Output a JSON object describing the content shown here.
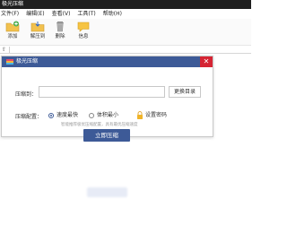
{
  "window": {
    "title": "极光压缩"
  },
  "menu": [
    {
      "label": "文件(F)"
    },
    {
      "label": "编辑(E)"
    },
    {
      "label": "查看(V)"
    },
    {
      "label": "工具(T)"
    },
    {
      "label": "帮助(H)"
    }
  ],
  "toolbar": {
    "add": "添加",
    "extract": "解压到",
    "delete": "删除",
    "info": "信息"
  },
  "dialog": {
    "title": "极光压缩",
    "close": "✕",
    "dest_label": "压缩到：",
    "dest_value": "",
    "change_dir": "更换目录",
    "config_label": "压缩配置：",
    "options": [
      {
        "label": "速度最快",
        "selected": true
      },
      {
        "label": "体积最小",
        "selected": false
      }
    ],
    "password": "设置密码",
    "hint": "智能推荐极优压缩配置，具有最优压缩速度",
    "submit": "立即压缩"
  },
  "colors": {
    "accent": "#3d5a97",
    "close": "#d52433",
    "titlebar": "#1f1f1f"
  }
}
